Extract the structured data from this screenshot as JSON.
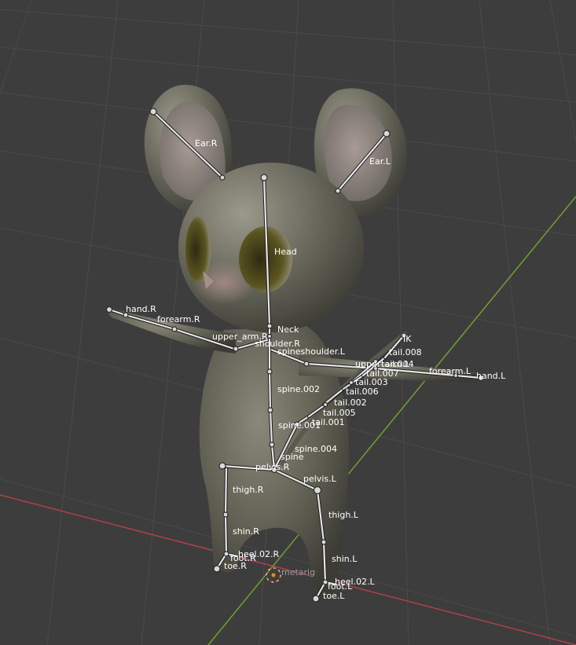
{
  "viewport": {
    "background": "#3d3d3d",
    "grid_color": "#4a4a4a",
    "x_axis_color": "#b0414a",
    "y_axis_color": "#71a12e",
    "mesh_color": "#6b6a5c"
  },
  "armature": {
    "object_name": "metarig",
    "bones": {
      "ear_r": "Ear.R",
      "ear_l": "Ear.L",
      "head": "Head",
      "neck": "Neck",
      "hand_r": "hand.R",
      "forearm_r": "forearm.R",
      "upper_arm_r": "upper_arm.R",
      "shoulder_r": "shoulder.R",
      "shoulder_l": "spineshoulder.L",
      "upper_arm_l": "upper_arm.L",
      "forearm_l": "forearm.L",
      "hand_l": "hand.L",
      "ik": "IK",
      "tail_008": "tail.008",
      "tail_007": "tail.007",
      "tail_004": "tail.004",
      "tail_003": "tail.003",
      "tail_006": "tail.006",
      "tail_002": "tail.002",
      "tail_005": "tail.005",
      "tail_001": "tail.001",
      "spine_002": "spine.002",
      "spine_001": "spine.001",
      "spine_004": "spine.004",
      "spine": "spine",
      "pelvis_r": "pelvis.R",
      "pelvis_l": "pelvis.L",
      "thigh_r": "thigh.R",
      "thigh_l": "thigh.L",
      "shin_r": "shin.R",
      "shin_l": "shin.L",
      "heel_r": "heel.02.R",
      "foot_r": "foot.R",
      "toe_r": "toe.R",
      "heel_l": "heel.02.L",
      "foot_l": "foot.L",
      "toe_l": "toe.L"
    }
  }
}
